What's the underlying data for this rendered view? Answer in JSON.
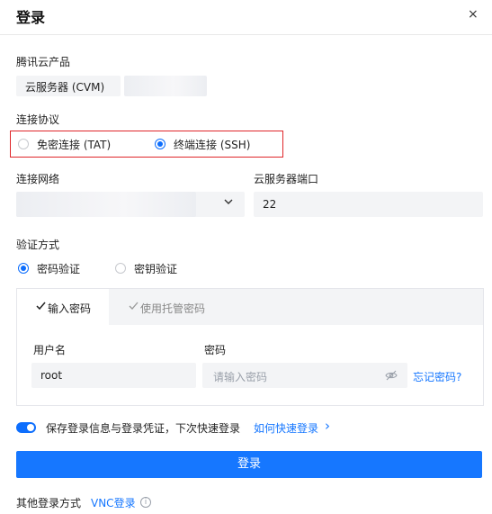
{
  "dialog": {
    "title": "登录",
    "close": "×"
  },
  "product": {
    "label": "腾讯云产品",
    "value": "云服务器 (CVM)"
  },
  "protocol": {
    "label": "连接协议",
    "options": [
      "免密连接 (TAT)",
      "终端连接 (SSH)"
    ],
    "selected": "终端连接 (SSH)",
    "highlight_color": "#e0262a"
  },
  "network": {
    "label": "连接网络",
    "value": ""
  },
  "port": {
    "label": "云服务器端口",
    "value": "22"
  },
  "auth": {
    "label": "验证方式",
    "options": [
      "密码验证",
      "密钥验证"
    ],
    "selected": "密码验证"
  },
  "tabs": {
    "items": [
      "输入密码",
      "使用托管密码"
    ],
    "active": "输入密码"
  },
  "credentials": {
    "username_label": "用户名",
    "username_value": "root",
    "password_label": "密码",
    "password_placeholder": "请输入密码",
    "forgot_link": "忘记密码?"
  },
  "save": {
    "enabled": true,
    "text": "保存登录信息与登录凭证，下次快速登录",
    "link": "如何快速登录",
    "chevron": "›"
  },
  "login_button": "登录",
  "other": {
    "label": "其他登录方式",
    "link": "VNC登录",
    "info": "i"
  },
  "colors": {
    "accent": "#1677ff",
    "field_bg": "#f3f4f6"
  },
  "icons": {
    "dropdown": "chevron-down-icon",
    "eye": "eye-off-icon",
    "check": "check-icon",
    "info": "info-icon"
  }
}
